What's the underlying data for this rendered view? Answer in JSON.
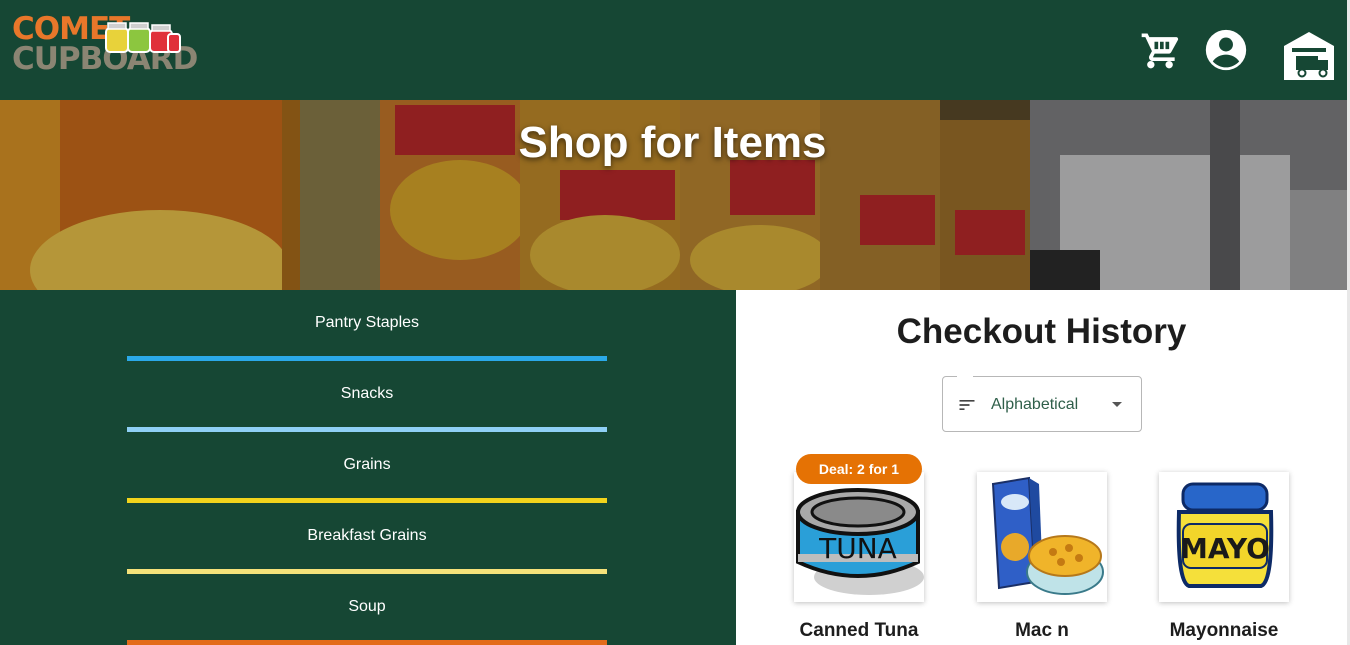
{
  "header": {
    "logo": {
      "line1": "COMET",
      "line2": "CUPBOARD"
    },
    "nav": [
      {
        "icon": "cart-icon"
      },
      {
        "icon": "account-icon"
      },
      {
        "icon": "warehouse-delivery-icon"
      }
    ],
    "colors": {
      "background": "#164734",
      "logo_orange": "#e8772a",
      "logo_gray": "#8b8573"
    }
  },
  "hero": {
    "title": "Shop for Items"
  },
  "categories": [
    {
      "label": "Pantry Staples",
      "color": "#2ba9e8"
    },
    {
      "label": "Snacks",
      "color": "#8fd0f5"
    },
    {
      "label": "Grains",
      "color": "#f2d41c"
    },
    {
      "label": "Breakfast Grains",
      "color": "#f5e27a"
    },
    {
      "label": "Soup",
      "color": "#e36b1a"
    }
  ],
  "checkout_history": {
    "title": "Checkout History",
    "sort": {
      "selected": "Alphabetical",
      "icon": "sort-icon"
    },
    "products": [
      {
        "name": "Canned Tuna",
        "badge": "Deal: 2 for 1",
        "image": "tuna-can-icon"
      },
      {
        "name": "Mac n",
        "image": "mac-and-cheese-icon"
      },
      {
        "name": "Mayonnaise",
        "image": "mayo-jar-icon"
      }
    ]
  },
  "colors": {
    "accent_orange": "#e57204",
    "panel_green": "#164734"
  }
}
